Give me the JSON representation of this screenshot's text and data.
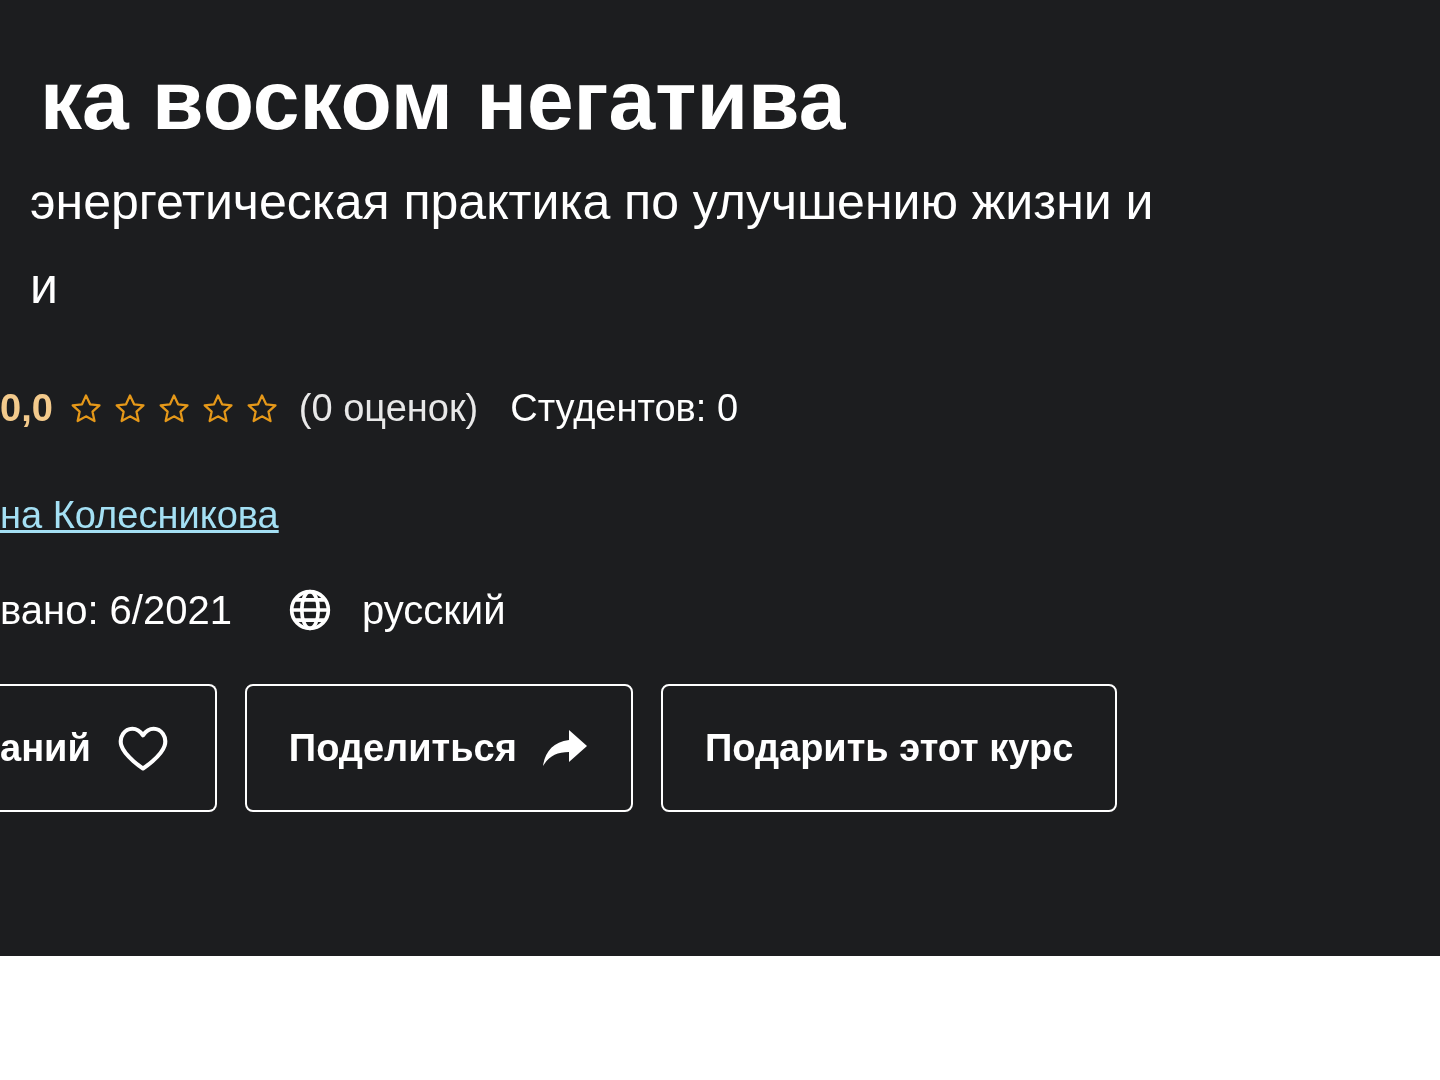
{
  "course": {
    "title": "ка воском негатива",
    "subtitle_lines": [
      "энергетическая практика по улучшению жизни и",
      "и"
    ],
    "rating": "0,0",
    "stars": 0,
    "ratings_count": "(0 оценок)",
    "students": "Студентов: 0",
    "author": "на Колесникова",
    "created": "вано: 6/2021",
    "language": "русский"
  },
  "buttons": [
    {
      "kind": "wishlist",
      "label": "аний"
    },
    {
      "kind": "share",
      "label": "Поделиться"
    },
    {
      "kind": "gift",
      "label": "Подарить этот курс"
    }
  ]
}
